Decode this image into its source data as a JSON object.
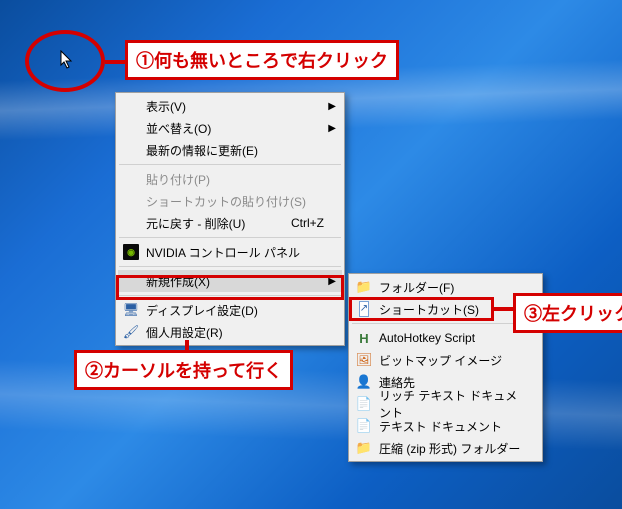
{
  "annotations": {
    "a1": "①何も無いところで右クリック",
    "a2": "②カーソルを持って行く",
    "a3": "③左クリック"
  },
  "menu1": {
    "view": "表示(V)",
    "sort": "並べ替え(O)",
    "refresh": "最新の情報に更新(E)",
    "paste": "貼り付け(P)",
    "paste_shortcut": "ショートカットの貼り付け(S)",
    "undo": "元に戻す - 削除(U)",
    "undo_key": "Ctrl+Z",
    "nvidia": "NVIDIA コントロール パネル",
    "new": "新規作成(X)",
    "display": "ディスプレイ設定(D)",
    "personalize": "個人用設定(R)"
  },
  "menu2": {
    "folder": "フォルダー(F)",
    "shortcut": "ショートカット(S)",
    "ahk": "AutoHotkey Script",
    "bmp": "ビットマップ イメージ",
    "contact": "連絡先",
    "rtf": "リッチ テキスト ドキュメント",
    "txt": "テキスト ドキュメント",
    "zip": "圧縮 (zip 形式) フォルダー"
  }
}
